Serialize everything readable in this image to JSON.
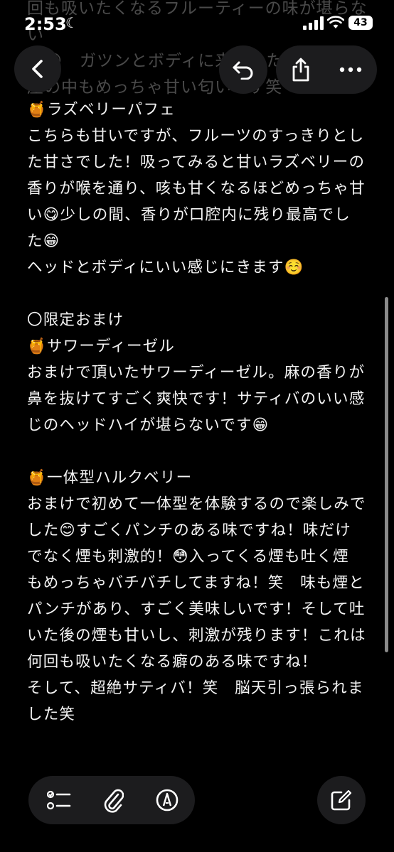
{
  "status": {
    "time": "2:53",
    "battery": "43"
  },
  "ghost_text": "回も吸いたくなるフルーティーの味が堪らない\n☺︎😊　ガツンとボディに来ました笑　部\n屋の中もめっちゃ甘い匂いです笑",
  "note": {
    "lines": [
      "🍯ラズベリーパフェ",
      "こちらも甘いですが、フルーツのすっきりとし",
      "た甘さでした！吸ってみると甘いラズベリーの",
      "香りが喉を通り、咳も甘くなるほどめっちゃ甘",
      "い😋少しの間、香りが口腔内に残り最高でし",
      "た😁",
      "ヘッドとボディにいい感じにきます☺️",
      "",
      "〇限定おまけ",
      "🍯サワーディーゼル",
      "おまけで頂いたサワーディーゼル。麻の香りが",
      "鼻を抜けてすごく爽快です！サティバのいい感",
      "じのヘッドハイが堪らないです😁",
      "",
      "🍯一体型ハルクベリー",
      "おまけで初めて一体型を体験するので楽しみで",
      "した😊すごくパンチのある味ですね！味だけ",
      "でなく煙も刺激的！😳入ってくる煙も吐く煙",
      "もめっちゃバチバチしてますね！笑　味も煙と",
      "パンチがあり、すごく美味しいです！そして吐",
      "いた後の煙も甘いし、刺激が残ります！これは",
      "何回も吸いたくなる癖のある味ですね！",
      "そして、超絶サティバ！笑　脳天引っ張られま",
      "した笑"
    ]
  },
  "icons": {
    "back": "chevron-left-icon",
    "undo": "undo-icon",
    "share": "share-icon",
    "more": "more-horizontal-icon",
    "checklist": "checklist-icon",
    "attach": "paperclip-icon",
    "markup": "pen-markup-icon",
    "compose": "compose-icon"
  }
}
